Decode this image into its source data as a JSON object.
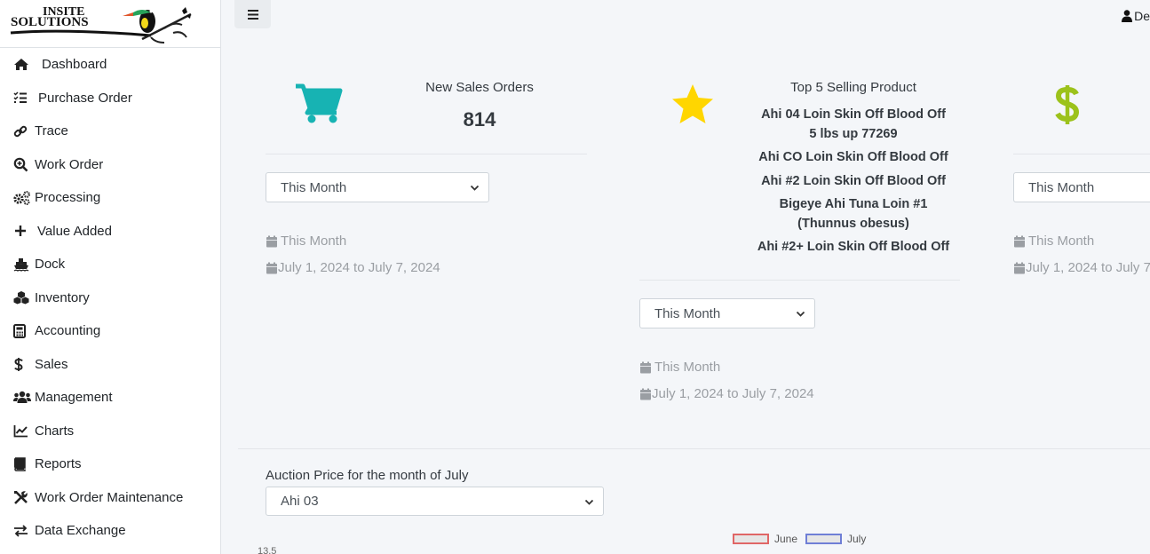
{
  "brand": {
    "line1": "INSITE",
    "line2": "SOLUTIONS"
  },
  "sidebar": {
    "items": [
      {
        "label": "Dashboard",
        "icon": "home-icon"
      },
      {
        "label": "Purchase Order",
        "icon": "list-check-icon"
      },
      {
        "label": "Trace",
        "icon": "link-icon"
      },
      {
        "label": "Work Order",
        "icon": "search-plus-icon"
      },
      {
        "label": "Processing",
        "icon": "cogs-icon"
      },
      {
        "label": "Value Added",
        "icon": "plus-icon"
      },
      {
        "label": "Dock",
        "icon": "ship-icon"
      },
      {
        "label": "Inventory",
        "icon": "cubes-icon"
      },
      {
        "label": "Accounting",
        "icon": "calculator-icon"
      },
      {
        "label": "Sales",
        "icon": "dollar-icon"
      },
      {
        "label": "Management",
        "icon": "users-icon"
      },
      {
        "label": "Charts",
        "icon": "chart-line-icon"
      },
      {
        "label": "Reports",
        "icon": "book-icon"
      },
      {
        "label": "Work Order Maintenance",
        "icon": "tools-icon"
      },
      {
        "label": "Data Exchange",
        "icon": "exchange-icon"
      }
    ]
  },
  "header": {
    "user_name": "De"
  },
  "cards": {
    "sales_orders": {
      "title": "New Sales Orders",
      "value": "814",
      "select_value": "This Month",
      "period_label": "This Month",
      "date_range": "July 1, 2024 to July 7, 2024",
      "icon_color": "#17b3b3"
    },
    "top_products": {
      "title": "Top 5 Selling Product",
      "products": [
        "Ahi 04 Loin Skin Off Blood Off",
        "5 lbs up 77269",
        "Ahi CO Loin Skin Off Blood Off",
        "Ahi #2 Loin Skin Off Blood Off",
        "Bigeye Ahi Tuna Loin #1",
        "(Thunnus obesus)",
        "Ahi #2+ Loin Skin Off Blood Off"
      ],
      "select_value": "This Month",
      "period_label": "This Month",
      "date_range": "July 1, 2024 to July 7, 2024",
      "icon_color": "#ffd600"
    },
    "revenue": {
      "select_value": "This Month",
      "period_label": "This Month",
      "date_range": "July 1, 2024 to July 7",
      "icon_color": "#9cc21b"
    }
  },
  "auction": {
    "label": "Auction Price for the month of July",
    "select_value": "Ahi 03"
  },
  "chart_data": {
    "type": "line",
    "series": [
      {
        "name": "June",
        "values": []
      },
      {
        "name": "July",
        "values": []
      }
    ],
    "y_tick_top": "13.5",
    "colors": {
      "June": "#e06666",
      "July": "#6f7fd6"
    }
  }
}
